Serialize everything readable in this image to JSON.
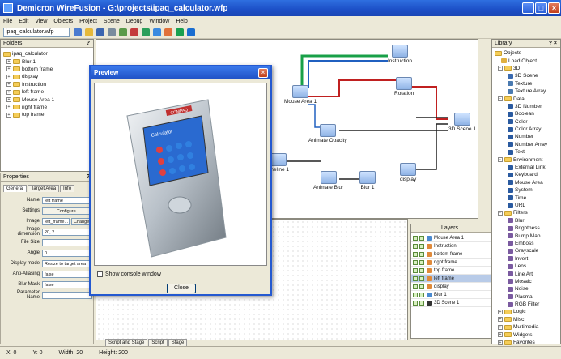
{
  "window": {
    "title": "Demicron WireFusion - G:\\projects\\ipaq_calculator.wfp"
  },
  "menu": [
    "File",
    "Edit",
    "View",
    "Objects",
    "Project",
    "Scene",
    "Debug",
    "Window",
    "Help"
  ],
  "toolbar": {
    "project": "ipaq_calculator.wfp"
  },
  "folders": {
    "title": "Folders",
    "items": [
      "ipaq_calculator",
      "Blur 1",
      "bottom frame",
      "display",
      "Instruction",
      "left frame",
      "Mouse Area 1",
      "right frame",
      "top frame"
    ]
  },
  "properties": {
    "title": "Properties",
    "tabs": [
      "General",
      "Target Area",
      "Info"
    ],
    "rows": [
      {
        "label": "Name",
        "value": "left frame"
      },
      {
        "label": "Settings",
        "value": "Configure..."
      },
      {
        "label": "Image",
        "value": "left_frame..."
      },
      {
        "label": "Image dimension",
        "value": "20, 2"
      },
      {
        "label": "File Size",
        "value": ""
      },
      {
        "label": "Angle",
        "value": "0"
      },
      {
        "label": "Display mode",
        "value": "Resize to target area"
      },
      {
        "label": "Anti-Aliasing",
        "value": "false"
      },
      {
        "label": "Blur Mask",
        "value": "false"
      },
      {
        "label": "Parameter Name",
        "value": ""
      }
    ],
    "change_label": "Change"
  },
  "nodes": [
    {
      "id": "instruction",
      "label": "Instruction"
    },
    {
      "id": "mouse",
      "label": "Mouse Area 1"
    },
    {
      "id": "rotation",
      "label": "Rotation"
    },
    {
      "id": "scene",
      "label": "3D Scene 1"
    },
    {
      "id": "opacity",
      "label": "Animate Opacity"
    },
    {
      "id": "timeline",
      "label": "imeline 1"
    },
    {
      "id": "animblur",
      "label": "Animate Blur"
    },
    {
      "id": "blur",
      "label": "Blur 1"
    },
    {
      "id": "display",
      "label": "display"
    }
  ],
  "layers": {
    "title": "Layers",
    "items": [
      "Mouse Area 1",
      "Instruction",
      "bottom frame",
      "right frame",
      "top frame",
      "left frame",
      "display",
      "Blur 1",
      "3D Scene 1"
    ]
  },
  "library": {
    "title": "Library",
    "items": [
      "Objects",
      "Load Object...",
      "3D",
      "3D Scene",
      "Texture",
      "Texture Array",
      "Data",
      "3D Number",
      "Boolean",
      "Color",
      "Color Array",
      "Number",
      "Number Array",
      "Text",
      "Environment",
      "External Link",
      "Keyboard",
      "Mouse Area",
      "System",
      "Time",
      "URL",
      "Filters",
      "Blur",
      "Brightness",
      "Bump Map",
      "Emboss",
      "Grayscale",
      "Invert",
      "Lens",
      "Line Art",
      "Mosaic",
      "Noise",
      "Plasma",
      "RGB Filter",
      "Logic",
      "Misc",
      "Multimedia",
      "Widgets",
      "Favorites"
    ]
  },
  "stage_tabs": [
    "Script and Stage",
    "Script",
    "Stage"
  ],
  "status": {
    "x": "X: 0",
    "y": "Y: 0",
    "width": "Width: 20",
    "height": "Height: 200"
  },
  "preview": {
    "title": "Preview",
    "console": "Show console window",
    "close": "Close",
    "screen_brand": "COMPAQ",
    "screen_label": "Calculator"
  }
}
